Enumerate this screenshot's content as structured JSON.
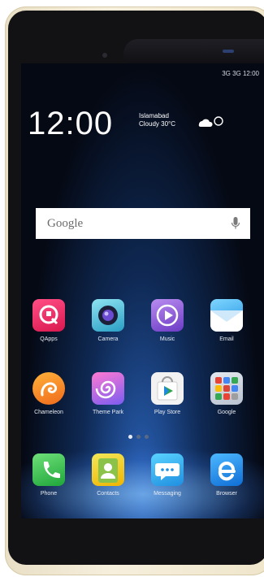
{
  "status": {
    "text": "3G 3G  12:00"
  },
  "lock": {
    "time": "12:00",
    "city": "Islamabad",
    "condition": "Cloudy 30°C"
  },
  "search": {
    "placeholder": "Google"
  },
  "apps": [
    {
      "label": "QApps"
    },
    {
      "label": "Camera"
    },
    {
      "label": "Music"
    },
    {
      "label": "Email"
    },
    {
      "label": "Chameleon"
    },
    {
      "label": "Theme Park"
    },
    {
      "label": "Play Store"
    },
    {
      "label": "Google"
    }
  ],
  "dock": [
    {
      "label": "Phone"
    },
    {
      "label": "Contacts"
    },
    {
      "label": "Messaging"
    },
    {
      "label": "Browser"
    }
  ],
  "page_dots": {
    "count": 3,
    "active": 0
  }
}
